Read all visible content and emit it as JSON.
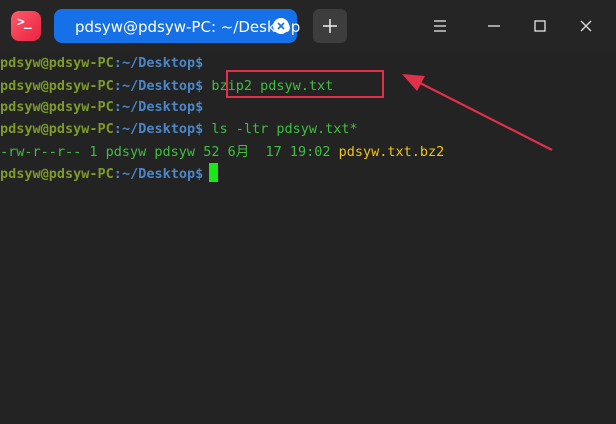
{
  "app": {
    "icon_glyph": ">_",
    "accent_color": "#1670e8"
  },
  "tabs": [
    {
      "title": "pdsyw@pdsyw-PC: ~/Desktop",
      "active": true
    }
  ],
  "titlebar": {
    "new_tab_icon": "plus-icon",
    "menu_icon": "hamburger-menu-icon",
    "minimize_icon": "minimize-icon",
    "maximize_icon": "maximize-icon",
    "close_icon": "close-icon"
  },
  "terminal": {
    "prompt_user": "pdsyw@pdsyw-PC",
    "prompt_sep": ":",
    "prompt_path": "~/Desktop",
    "prompt_symbol": "$",
    "lines": [
      {
        "command": ""
      },
      {
        "command": " bzip2 pdsyw.txt "
      },
      {
        "command": ""
      },
      {
        "command": " ls -ltr pdsyw.txt*"
      },
      {
        "output_meta": "-rw-r--r-- 1 pdsyw pdsyw 52 6月  17 19:02 ",
        "output_file": "pdsyw.txt.bz2"
      },
      {
        "command": ""
      }
    ],
    "colors": {
      "user": "#7d9a2a",
      "path": "#4a86c8",
      "command": "#3fbf3f",
      "file": "#f0c419",
      "cursor": "#18e818"
    }
  },
  "annotation": {
    "box_color": "#e0304a",
    "arrow_color": "#e0304a"
  }
}
